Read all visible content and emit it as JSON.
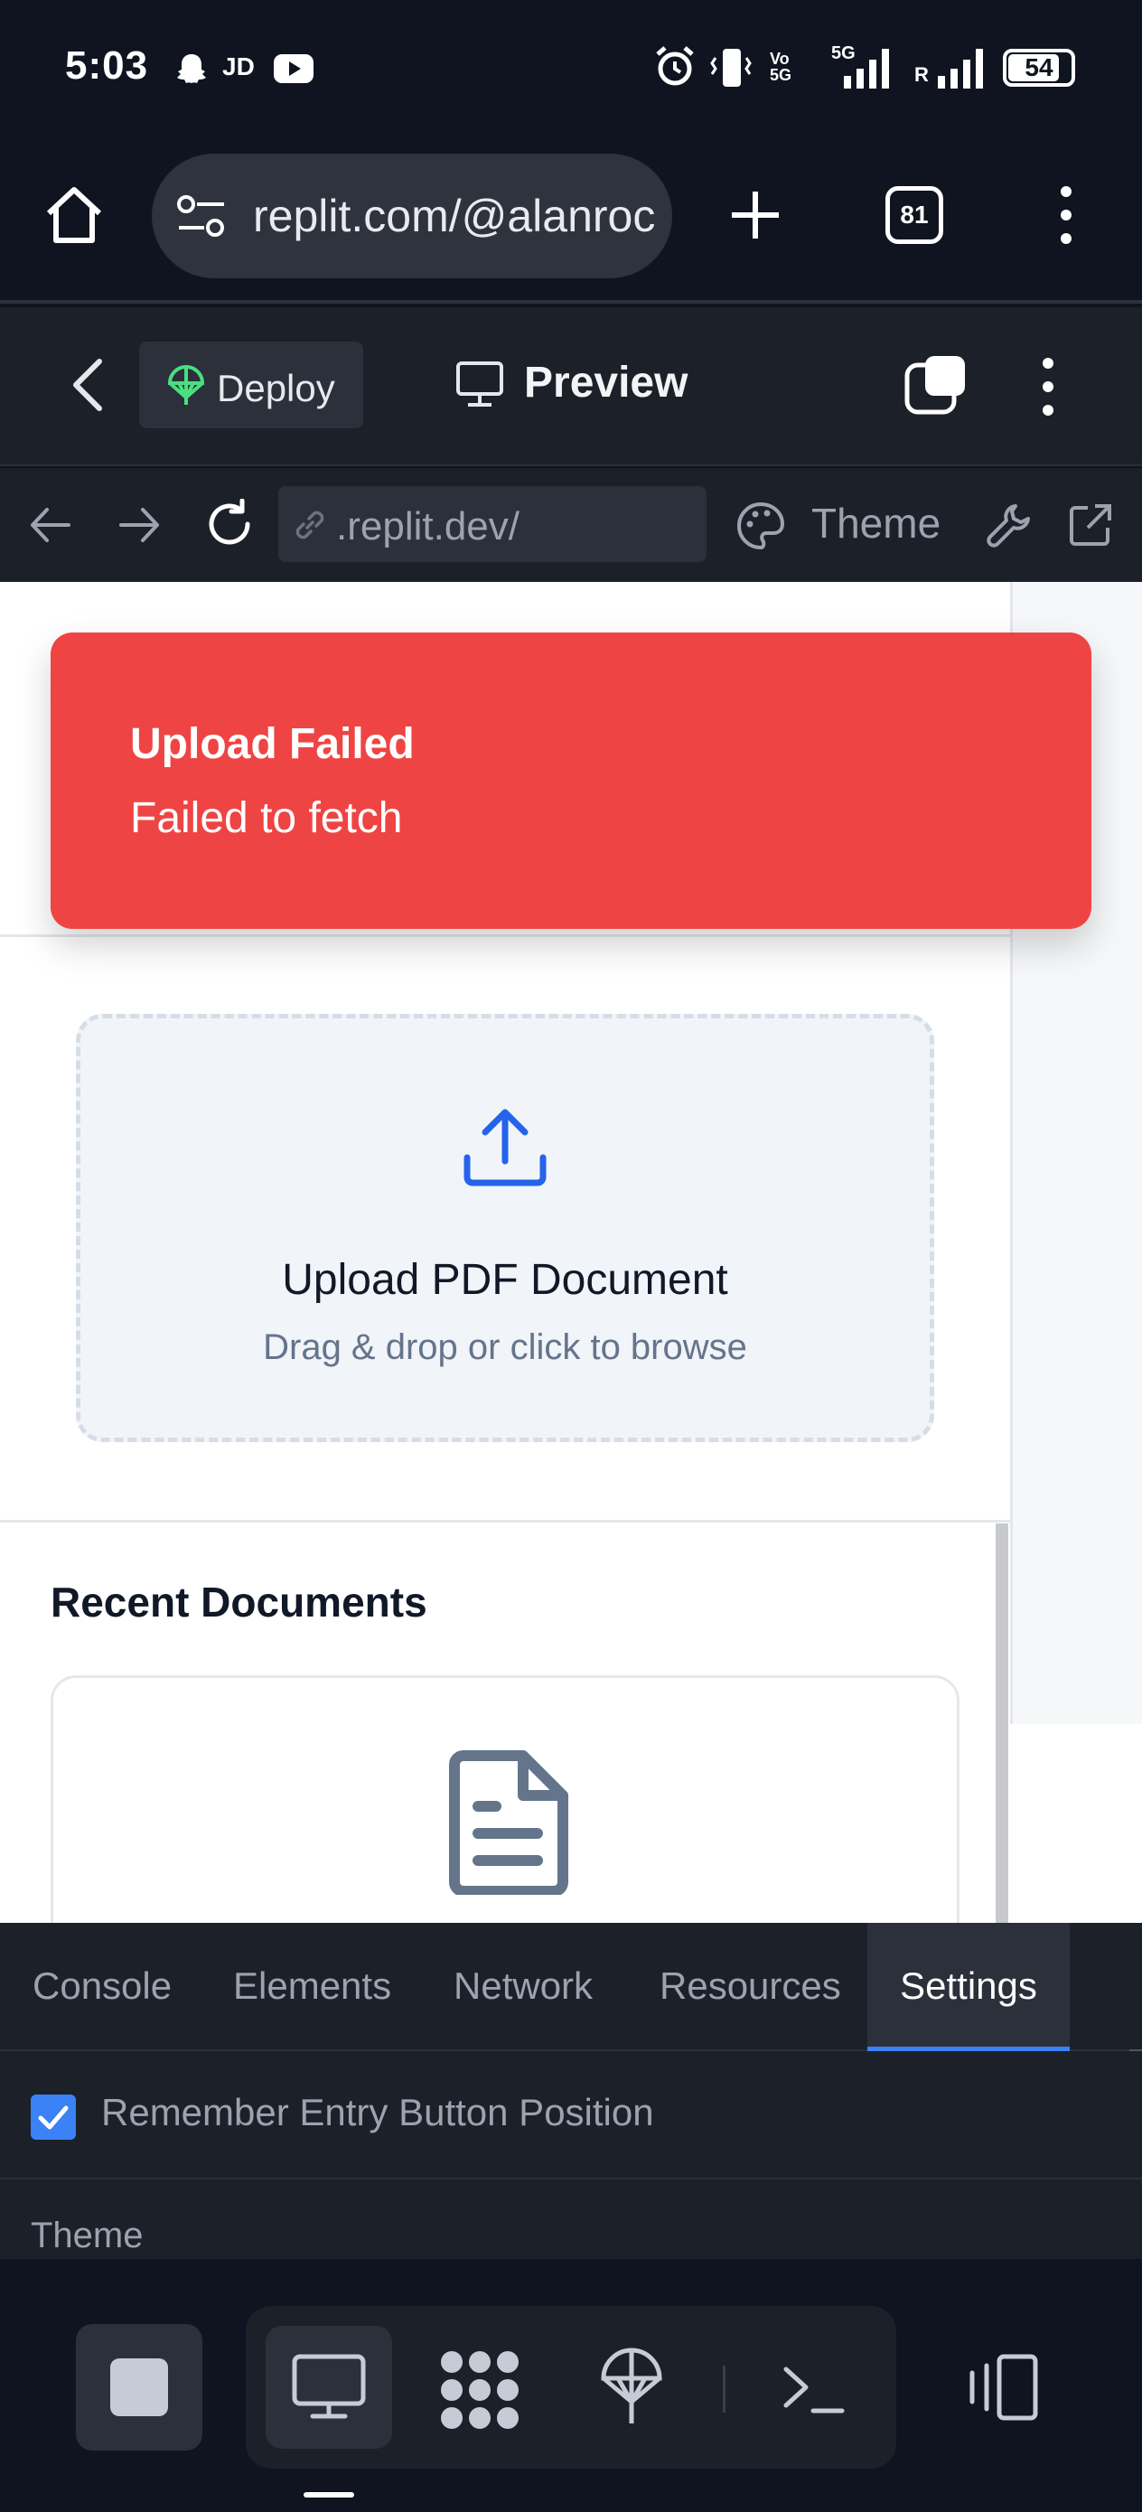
{
  "status_bar": {
    "time": "5:03",
    "carrier_tag": "JD",
    "network": "5G",
    "roaming": "R",
    "battery": "54"
  },
  "browser": {
    "url": "replit.com/@alanroc",
    "tab_count": "81"
  },
  "replit_header": {
    "deploy_label": "Deploy",
    "preview_label": "Preview"
  },
  "preview_toolbar": {
    "url": ".replit.dev/",
    "theme_label": "Theme"
  },
  "toast": {
    "title": "Upload Failed",
    "message": "Failed to fetch",
    "color": "#ef4444"
  },
  "upload": {
    "title": "Upload PDF Document",
    "subtitle": "Drag & drop or click to browse",
    "icon_color": "#2563eb"
  },
  "recent": {
    "heading": "Recent Documents"
  },
  "devtools": {
    "tabs": [
      "Console",
      "Elements",
      "Network",
      "Resources",
      "Settings"
    ],
    "active_tab": "Settings",
    "settings": {
      "remember_entry_label": "Remember Entry Button Position",
      "remember_entry_checked": true,
      "theme_heading": "Theme"
    },
    "accent": "#3b82f6"
  },
  "bottom_bar": {
    "icons": [
      "stop-icon",
      "monitor-icon",
      "workspace-icon",
      "deploy-icon",
      "terminal-icon",
      "device-icon"
    ]
  }
}
